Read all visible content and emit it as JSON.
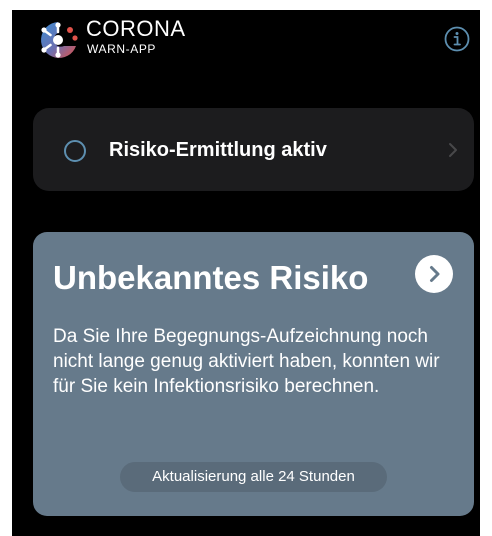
{
  "header": {
    "app_title": "CORONA",
    "app_subtitle": "WARN-APP",
    "logo_icon": "corona-virus-logo-icon",
    "info_icon": "info-icon"
  },
  "tracking_status": {
    "label": "Risiko-Ermittlung aktiv",
    "status_icon": "circle-status-icon",
    "chevron_icon": "chevron-right-icon"
  },
  "risk_card": {
    "title": "Unbekanntes Risiko",
    "description": "Da Sie Ihre Begegnungs-Aufzeichnung noch nicht lange genug aktiviert haben, konnten wir für Sie kein Infektionsrisiko berechnen.",
    "update_note": "Aktualisierung alle 24 Stunden",
    "arrow_icon": "chevron-right-circle-icon"
  },
  "colors": {
    "background": "#000000",
    "status_card": "#1c1c1e",
    "risk_card": "#667a8b",
    "accent": "#5d8fb0",
    "logo_blue": "#3c8cd2",
    "logo_red": "#e0524a"
  }
}
